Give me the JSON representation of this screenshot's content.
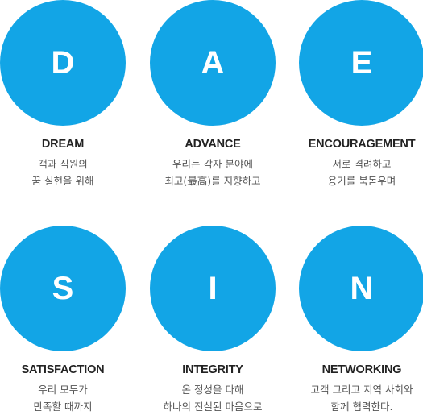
{
  "values": [
    {
      "letter": "D",
      "title": "DREAM",
      "desc_line1": "객과 직원의",
      "desc_line2": "꿈 실현을 위해"
    },
    {
      "letter": "A",
      "title": "ADVANCE",
      "desc_line1": "우리는 각자 분야에",
      "desc_line2": "최고(最高)를 지향하고"
    },
    {
      "letter": "E",
      "title": "ENCOURAGEMENT",
      "desc_line1": "서로 격려하고",
      "desc_line2": "용기를 북돋우며"
    },
    {
      "letter": "S",
      "title": "SATISFACTION",
      "desc_line1": "우리 모두가",
      "desc_line2": "만족할 때까지"
    },
    {
      "letter": "I",
      "title": "INTEGRITY",
      "desc_line1": "온 정성을 다해",
      "desc_line2": "하나의 진실된 마음으로"
    },
    {
      "letter": "N",
      "title": "NETWORKING",
      "desc_line1": "고객 그리고 지역 사회와",
      "desc_line2": "함께 협력한다."
    }
  ],
  "colors": {
    "circle": "#12a5e6",
    "letter": "#ffffff",
    "title": "#222222",
    "desc": "#555555"
  }
}
